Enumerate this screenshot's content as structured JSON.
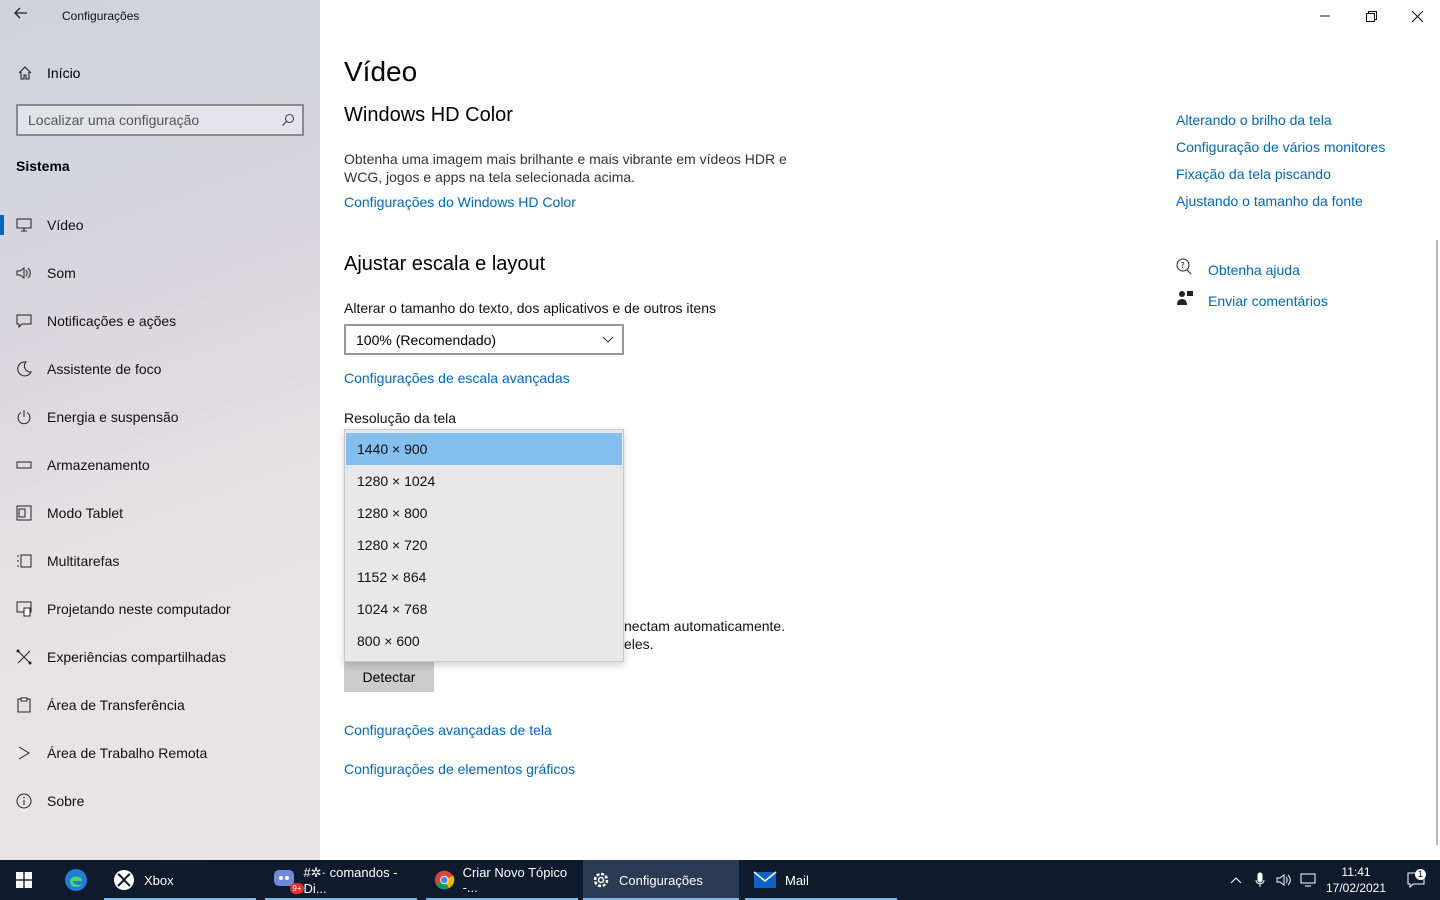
{
  "window": {
    "title": "Configurações"
  },
  "sidebar": {
    "home_label": "Início",
    "search_placeholder": "Localizar uma configuração",
    "section_header": "Sistema",
    "items": [
      {
        "label": "Vídeo",
        "icon": "monitor-icon",
        "active": true
      },
      {
        "label": "Som",
        "icon": "speaker-icon"
      },
      {
        "label": "Notificações e ações",
        "icon": "notification-icon"
      },
      {
        "label": "Assistente de foco",
        "icon": "moon-icon"
      },
      {
        "label": "Energia e suspensão",
        "icon": "power-icon"
      },
      {
        "label": "Armazenamento",
        "icon": "storage-icon"
      },
      {
        "label": "Modo Tablet",
        "icon": "tablet-icon"
      },
      {
        "label": "Multitarefas",
        "icon": "multitask-icon"
      },
      {
        "label": "Projetando neste computador",
        "icon": "project-icon"
      },
      {
        "label": "Experiências compartilhadas",
        "icon": "share-icon"
      },
      {
        "label": "Área de Transferência",
        "icon": "clipboard-icon"
      },
      {
        "label": "Área de Trabalho Remota",
        "icon": "remote-icon"
      },
      {
        "label": "Sobre",
        "icon": "info-icon"
      }
    ]
  },
  "main": {
    "title": "Vídeo",
    "hdr": {
      "heading": "Windows HD Color",
      "description_line1": "Obtenha uma imagem mais brilhante e mais vibrante em vídeos HDR e",
      "description_line2": "WCG, jogos e apps na tela selecionada acima.",
      "link": "Configurações do Windows HD Color"
    },
    "scale": {
      "heading": "Ajustar escala e layout",
      "size_label": "Alterar o tamanho do texto, dos aplicativos e de outros itens",
      "size_value": "100% (Recomendado)",
      "advanced_link": "Configurações de escala avançadas",
      "resolution_label": "Resolução da tela",
      "resolution_options": [
        "1440 × 900",
        "1280 × 1024",
        "1280 × 800",
        "1280 × 720",
        "1152 × 864",
        "1024 × 768",
        "800 × 600"
      ],
      "resolution_selected": "1440 × 900"
    },
    "multi": {
      "partial_line1": "nectam automaticamente.",
      "partial_line2": "eles.",
      "detect_button": "Detectar"
    },
    "links": {
      "advanced_display": "Configurações avançadas de tela",
      "graphics": "Configurações de elementos gráficos"
    },
    "related": [
      "Alterando o brilho da tela",
      "Configuração de vários monitores",
      "Fixação da tela piscando",
      "Ajustando o tamanho da fonte"
    ],
    "help": {
      "get_help": "Obtenha ajuda",
      "feedback": "Enviar comentários"
    }
  },
  "taskbar": {
    "apps": [
      {
        "label": "Xbox",
        "icon": "xbox-icon"
      },
      {
        "label": "#✲· comandos - Di...",
        "icon": "discord-icon",
        "badge": "9+"
      },
      {
        "label": "Criar Novo Tópico -...",
        "icon": "chrome-icon"
      },
      {
        "label": "Configurações",
        "icon": "gear-icon",
        "active": true
      },
      {
        "label": "Mail",
        "icon": "mail-icon"
      }
    ],
    "time": "11:41",
    "date": "17/02/2021",
    "notification_count": "1",
    "accent": "#76b9ed"
  }
}
